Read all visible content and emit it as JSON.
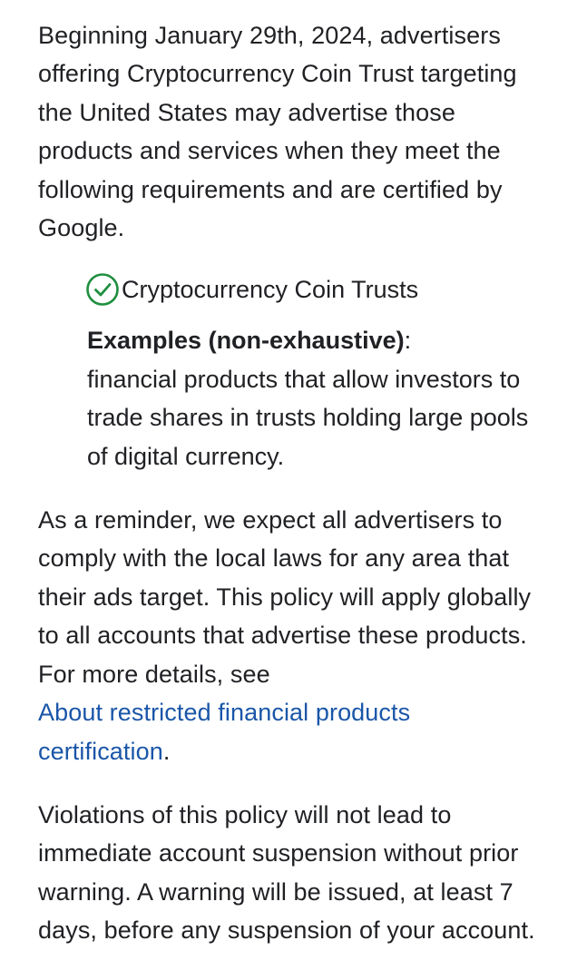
{
  "intro_text": "Beginning January 29th, 2024, advertisers offering Cryptocurrency Coin Trust targeting the United States may advertise those products and services when they meet the following requirements and are certified by Google.",
  "item": {
    "icon": "check-circle-icon",
    "icon_color": "#1e8e3e",
    "label": "Cryptocurrency Coin Trusts"
  },
  "examples": {
    "heading": "Examples (non-exhaustive)",
    "colon": ":",
    "text": "financial products that allow investors to trade shares in trusts holding large pools of digital currency."
  },
  "reminder": {
    "text": "As a reminder, we expect all advertisers to comply with the local laws for any area that their ads target. This policy will apply globally to all accounts that advertise these products. For more details, see",
    "link_text": "About restricted financial products certification",
    "link_color": "#1a56a8",
    "trailing": "."
  },
  "violations_text": "Violations of this policy will not lead to immediate account suspension without prior warning. A warning will be issued, at least 7 days, before any suspension of your account."
}
